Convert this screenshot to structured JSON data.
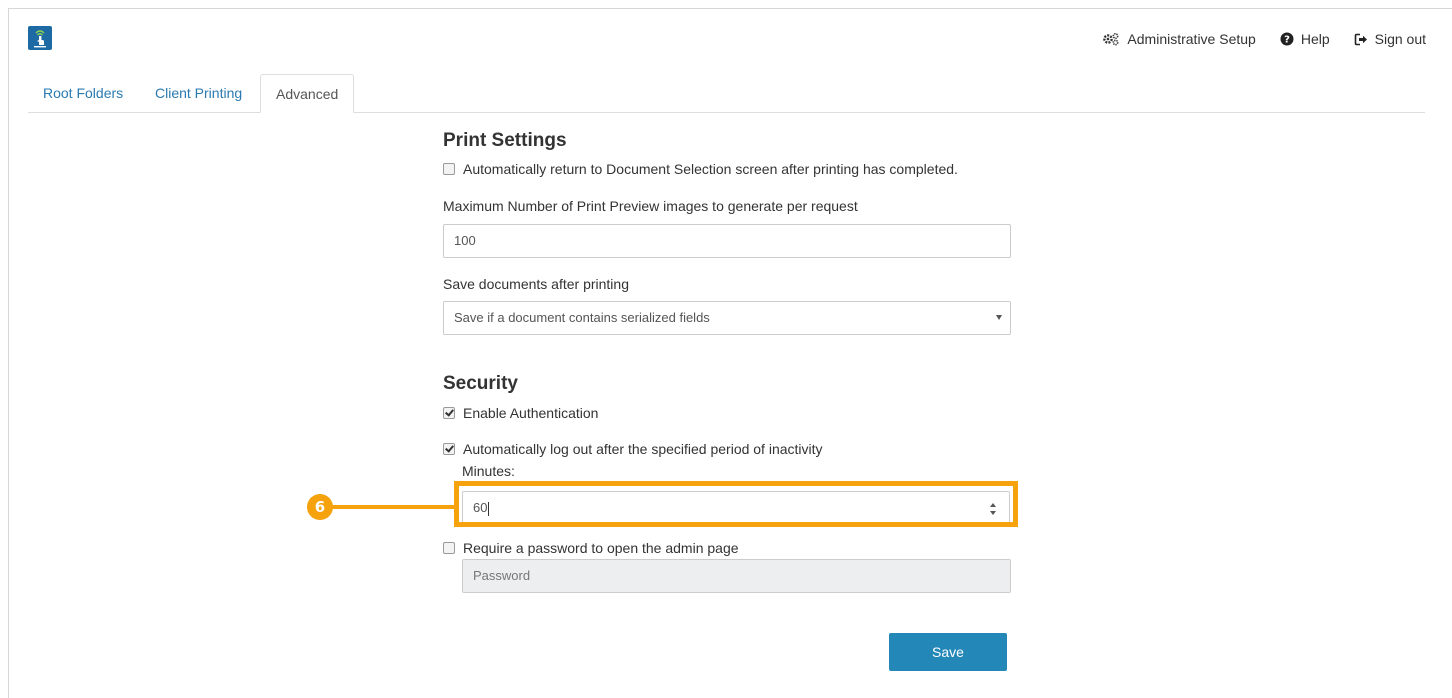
{
  "header": {
    "nav": {
      "admin_setup": "Administrative Setup",
      "help": "Help",
      "sign_out": "Sign out"
    }
  },
  "tabs": [
    {
      "label": "Root Folders",
      "active": false
    },
    {
      "label": "Client Printing",
      "active": false
    },
    {
      "label": "Advanced",
      "active": true
    }
  ],
  "print_settings": {
    "heading": "Print Settings",
    "auto_return": {
      "label": "Automatically return to Document Selection screen after printing has completed.",
      "checked": false
    },
    "max_preview": {
      "label": "Maximum Number of Print Preview images to generate per request",
      "value": "100"
    },
    "save_after_print": {
      "label": "Save documents after printing",
      "selected": "Save if a document contains serialized fields"
    }
  },
  "security": {
    "heading": "Security",
    "enable_auth": {
      "label": "Enable Authentication",
      "checked": true
    },
    "auto_logout": {
      "label": "Automatically log out after the specified period of inactivity",
      "checked": true,
      "minutes_label": "Minutes:",
      "minutes_value": "60"
    },
    "require_password": {
      "label": "Require a password to open the admin page",
      "checked": false,
      "password_placeholder": "Password"
    }
  },
  "callout": {
    "number": "6",
    "color": "#f5a20d"
  },
  "actions": {
    "save_label": "Save",
    "save_color": "#2387b8"
  }
}
